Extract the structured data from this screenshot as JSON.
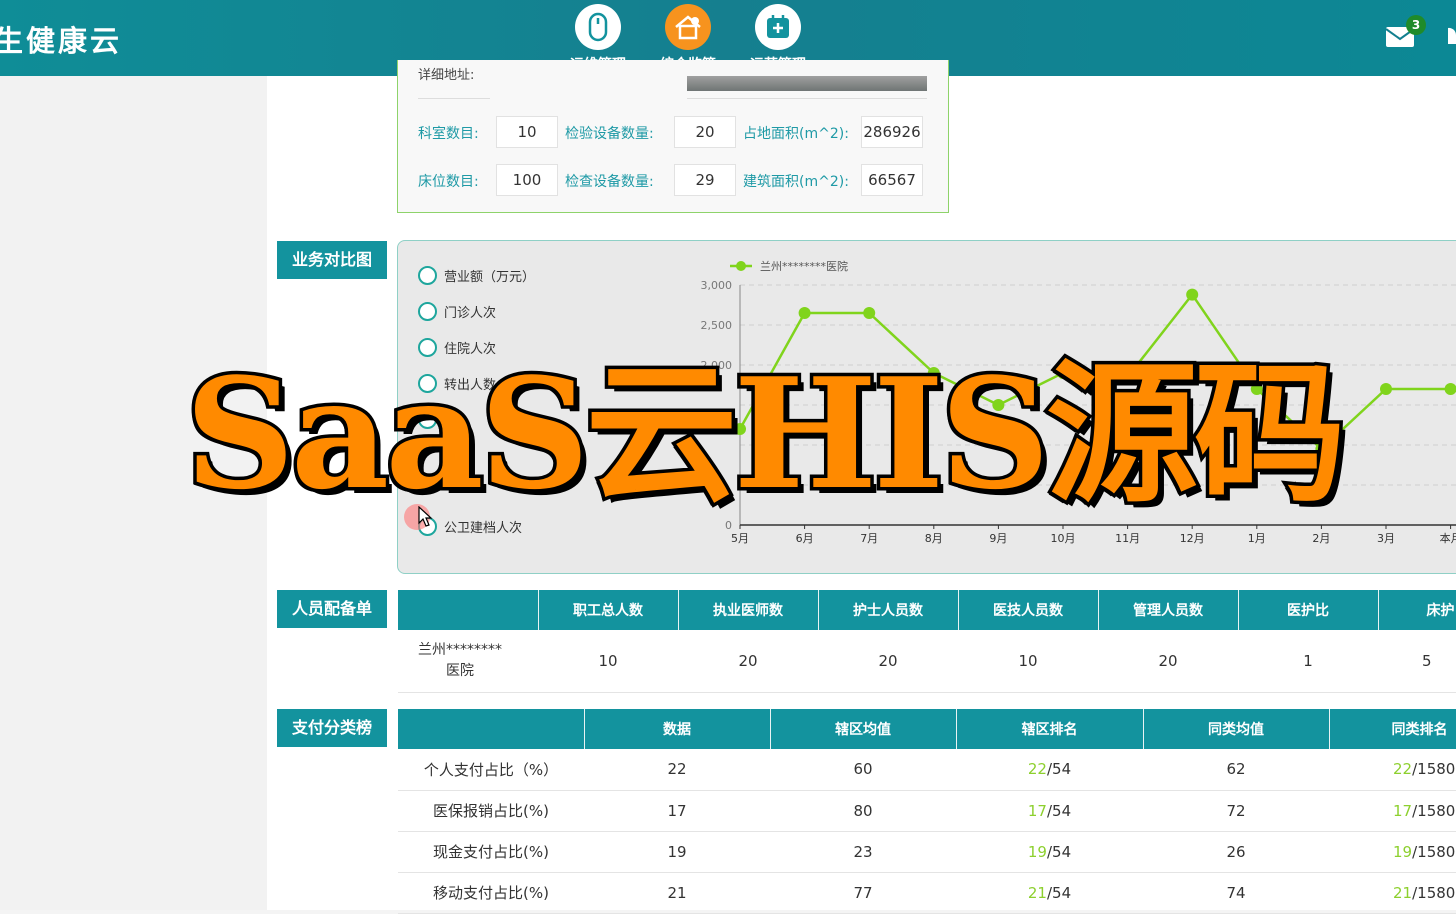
{
  "header": {
    "brand": "生健康云",
    "nav": [
      {
        "label": "运维管理",
        "icon": "mouse-icon"
      },
      {
        "label": "综合监管",
        "icon": "home-gear-icon"
      },
      {
        "label": "运营管理",
        "icon": "calendar-medical-icon"
      }
    ],
    "mail_badge": "3",
    "colors": {
      "bar": "#127f8f",
      "accent": "#13939e",
      "highlight": "#8dd02e"
    }
  },
  "hospital_info": {
    "address_label": "详细地址:",
    "rows": [
      [
        {
          "label": "科室数目:",
          "value": "10"
        },
        {
          "label": "检验设备数量:",
          "value": "20"
        },
        {
          "label": "占地面积(m^2):",
          "value": "286926"
        }
      ],
      [
        {
          "label": "床位数目:",
          "value": "100"
        },
        {
          "label": "检查设备数量:",
          "value": "29"
        },
        {
          "label": "建筑面积(m^2):",
          "value": "66567"
        }
      ]
    ]
  },
  "business": {
    "section_label": "业务对比图",
    "options": [
      "营业额（万元）",
      "门诊人次",
      "住院人次",
      "转出人数",
      "",
      "",
      "",
      "公卫建档人次"
    ]
  },
  "chart_data": {
    "type": "line",
    "title": "",
    "xlabel": "",
    "ylabel": "",
    "categories": [
      "5月",
      "6月",
      "7月",
      "8月",
      "9月",
      "10月",
      "11月",
      "12月",
      "1月",
      "2月",
      "3月",
      "本月"
    ],
    "series": [
      {
        "name": "兰州********医院",
        "color": "#80d41c",
        "values": [
          1200,
          2650,
          2650,
          1900,
          1500,
          1900,
          1850,
          2880,
          1700,
          950,
          1700,
          1700
        ]
      }
    ],
    "ylim": [
      0,
      3000
    ],
    "yticks": [
      0,
      500,
      1000,
      1500,
      2000,
      2500,
      3000
    ],
    "ytick_labels": [
      "0",
      "",
      "",
      "",
      "2,000",
      "2,500",
      "3,000"
    ],
    "grid": true,
    "legend": "top-left"
  },
  "staff": {
    "section_label": "人员配备单",
    "columns": [
      "",
      "职工总人数",
      "执业医师数",
      "护士人员数",
      "医技人员数",
      "管理人员数",
      "医护比",
      "床护"
    ],
    "row": [
      "兰州********医院",
      "10",
      "20",
      "20",
      "10",
      "20",
      "1",
      "5"
    ]
  },
  "payment": {
    "section_label": "支付分类榜",
    "columns": [
      "",
      "数据",
      "辖区均值",
      "辖区排名",
      "同类均值",
      "同类排名"
    ],
    "rows": [
      {
        "name": "个人支付占比（%）",
        "data": "22",
        "area_avg": "60",
        "area_rank": "22",
        "area_total": "/54",
        "peer_avg": "62",
        "peer_rank": "22",
        "peer_total": "/1580"
      },
      {
        "name": "医保报销占比(%)",
        "data": "17",
        "area_avg": "80",
        "area_rank": "17",
        "area_total": "/54",
        "peer_avg": "72",
        "peer_rank": "17",
        "peer_total": "/1580"
      },
      {
        "name": "现金支付占比(%)",
        "data": "19",
        "area_avg": "23",
        "area_rank": "19",
        "area_total": "/54",
        "peer_avg": "26",
        "peer_rank": "19",
        "peer_total": "/1580"
      },
      {
        "name": "移动支付占比(%)",
        "data": "21",
        "area_avg": "77",
        "area_rank": "21",
        "area_total": "/54",
        "peer_avg": "74",
        "peer_rank": "21",
        "peer_total": "/1580"
      }
    ]
  },
  "overlay_text": "SaaS云HIS源码"
}
